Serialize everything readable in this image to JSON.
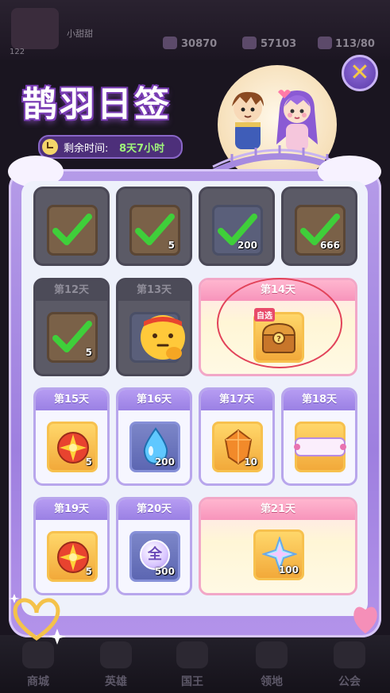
{
  "hud": {
    "player_name": "小甜甜",
    "player_level": "122",
    "resources": [
      "30870",
      "57103",
      "113/80"
    ]
  },
  "bottom_nav": [
    "商城",
    "英雄",
    "国王",
    "领地",
    "公会"
  ],
  "event": {
    "title": "鹊羽日签",
    "timer_label": "剩余时间:",
    "timer_value": "8天7小时"
  },
  "days": [
    {
      "label": "",
      "item": "hammer-scroll",
      "qty": "",
      "state": "claimed"
    },
    {
      "label": "",
      "item": "compass-medal",
      "qty": "5",
      "state": "claimed"
    },
    {
      "label": "",
      "item": "water-drop",
      "qty": "200",
      "state": "claimed"
    },
    {
      "label": "",
      "item": "blue-gem",
      "qty": "666",
      "state": "claimed"
    },
    {
      "label": "第12天",
      "item": "compass-medal",
      "qty": "5",
      "state": "claimed"
    },
    {
      "label": "第13天",
      "item": "thinking-emoji",
      "qty": "",
      "state": "today"
    },
    {
      "label": "第14天",
      "item": "treasure-chest",
      "qty": "",
      "state": "big",
      "tag": "自选"
    },
    {
      "label": "第15天",
      "item": "sun-medal",
      "qty": "5",
      "state": "future"
    },
    {
      "label": "第16天",
      "item": "water-drop",
      "qty": "200",
      "state": "future"
    },
    {
      "label": "第17天",
      "item": "orange-crystal",
      "qty": "10",
      "state": "future"
    },
    {
      "label": "第18天",
      "item": "name-frame",
      "qty": "",
      "state": "future"
    },
    {
      "label": "第19天",
      "item": "sun-medal",
      "qty": "5",
      "state": "future"
    },
    {
      "label": "第20天",
      "item": "all-token",
      "qty": "500",
      "state": "future",
      "token_text": "全"
    },
    {
      "label": "第21天",
      "item": "rainbow-star",
      "qty": "100",
      "state": "big"
    }
  ],
  "colors": {
    "accent_purple": "#9e7fdf",
    "timer_green": "#9ff57a",
    "check_green": "#3fcf3a",
    "highlight_ring": "#e2435a"
  }
}
